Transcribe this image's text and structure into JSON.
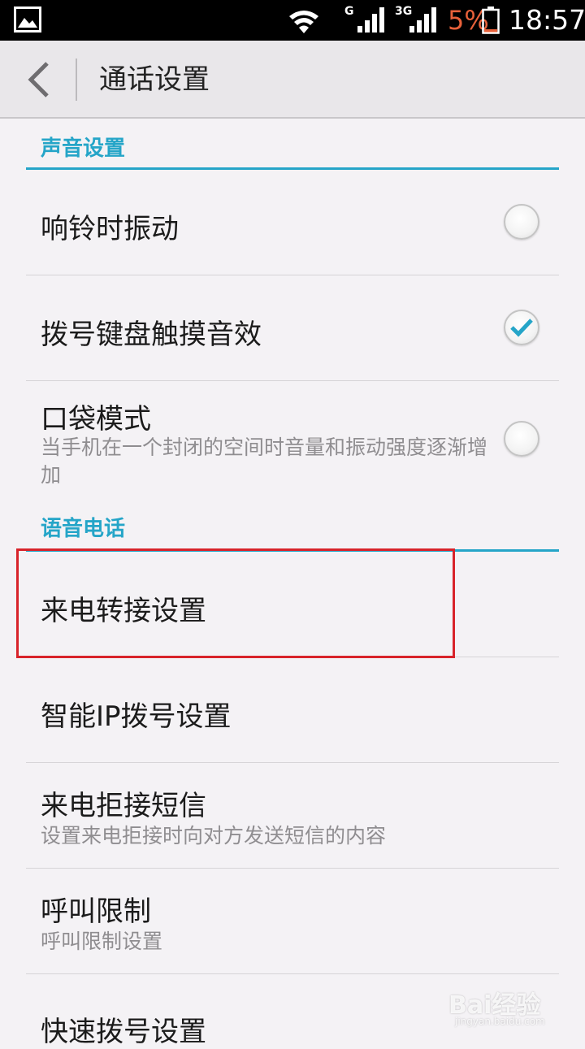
{
  "status_bar": {
    "gallery_icon": "image-notification-icon",
    "wifi_icon": "wifi-icon",
    "signal1_label": "G",
    "signal2_label": "3G",
    "battery_percent": "5%",
    "battery_color": "#e8613a",
    "time": "18:57"
  },
  "action_bar": {
    "back_icon": "chevron-left-icon",
    "title": "通话设置"
  },
  "sections": {
    "sound": {
      "header": "声音设置",
      "items": [
        {
          "title": "响铃时振动",
          "checked": false
        },
        {
          "title": "拨号键盘触摸音效",
          "checked": true
        },
        {
          "title": "口袋模式",
          "subtitle": "当手机在一个封闭的空间时音量和振动强度逐渐增加",
          "checked": false
        }
      ]
    },
    "voice_call": {
      "header": "语音电话",
      "items": [
        {
          "title": "来电转接设置"
        },
        {
          "title": "智能IP拨号设置"
        },
        {
          "title": "来电拒接短信",
          "subtitle": "设置来电拒接时向对方发送短信的内容"
        },
        {
          "title": "呼叫限制",
          "subtitle": "呼叫限制设置"
        },
        {
          "title": "快速拨号设置"
        }
      ]
    }
  },
  "accent_color": "#25a5c8",
  "highlight_color": "#d8232a",
  "watermark": {
    "text": "Bai经验",
    "sub": "jingyan.baidu.com"
  }
}
